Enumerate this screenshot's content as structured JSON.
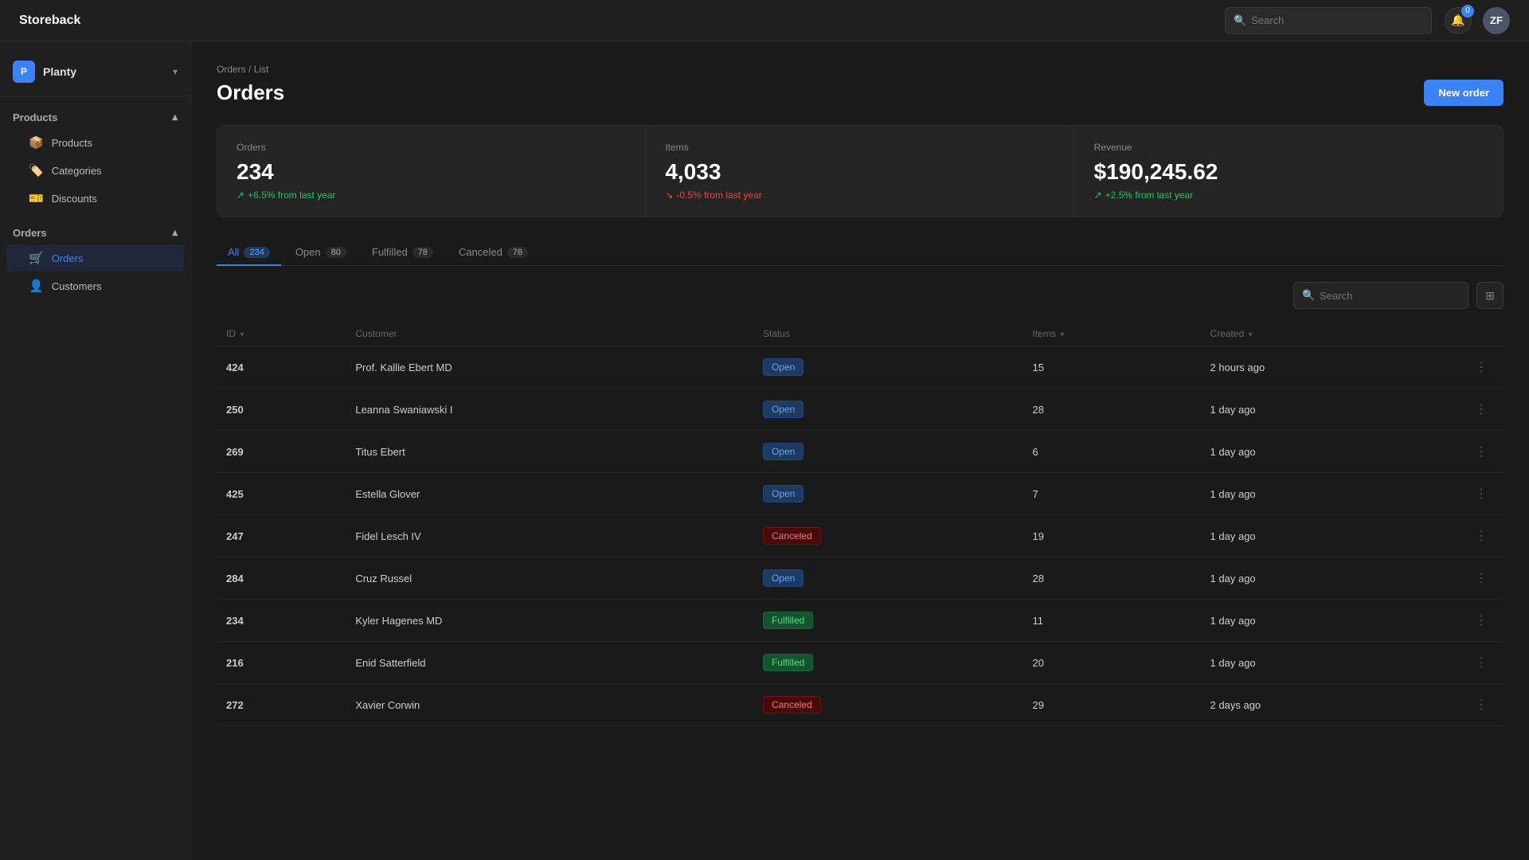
{
  "app": {
    "logo": "Storeback",
    "search_placeholder": "Search",
    "avatar_initials": "ZF",
    "notification_count": "0"
  },
  "sidebar": {
    "workspace": {
      "icon_letter": "P",
      "name": "Planty"
    },
    "sections": [
      {
        "label": "Products",
        "items": [
          {
            "label": "Products",
            "icon": "📦",
            "id": "products"
          },
          {
            "label": "Categories",
            "icon": "🏷️",
            "id": "categories"
          },
          {
            "label": "Discounts",
            "icon": "🎫",
            "id": "discounts"
          }
        ]
      },
      {
        "label": "Orders",
        "items": [
          {
            "label": "Orders",
            "icon": "🛒",
            "id": "orders",
            "active": true
          },
          {
            "label": "Customers",
            "icon": "👤",
            "id": "customers"
          }
        ]
      }
    ]
  },
  "breadcrumb": {
    "parent": "Orders",
    "separator": "/",
    "current": "List"
  },
  "page": {
    "title": "Orders",
    "new_order_label": "New order"
  },
  "stats": [
    {
      "label": "Orders",
      "value": "234",
      "change": "+6.5% from last year",
      "positive": true
    },
    {
      "label": "Items",
      "value": "4,033",
      "change": "-0.5% from last year",
      "positive": false
    },
    {
      "label": "Revenue",
      "value": "$190,245.62",
      "change": "+2.5% from last year",
      "positive": true
    }
  ],
  "tabs": [
    {
      "label": "All",
      "count": "234",
      "active": true,
      "id": "all"
    },
    {
      "label": "Open",
      "count": "80",
      "active": false,
      "id": "open"
    },
    {
      "label": "Fulfilled",
      "count": "78",
      "active": false,
      "id": "fulfilled"
    },
    {
      "label": "Canceled",
      "count": "76",
      "active": false,
      "id": "canceled"
    }
  ],
  "table": {
    "search_placeholder": "Search",
    "columns": [
      {
        "label": "ID",
        "sortable": true
      },
      {
        "label": "Customer",
        "sortable": false
      },
      {
        "label": "Status",
        "sortable": false
      },
      {
        "label": "Items",
        "sortable": true
      },
      {
        "label": "Created",
        "sortable": true
      }
    ],
    "rows": [
      {
        "id": "424",
        "customer": "Prof. Kallie Ebert MD",
        "status": "Open",
        "status_type": "open",
        "items": "15",
        "created": "2 hours ago"
      },
      {
        "id": "250",
        "customer": "Leanna Swaniawski I",
        "status": "Open",
        "status_type": "open",
        "items": "28",
        "created": "1 day ago"
      },
      {
        "id": "269",
        "customer": "Titus Ebert",
        "status": "Open",
        "status_type": "open",
        "items": "6",
        "created": "1 day ago"
      },
      {
        "id": "425",
        "customer": "Estella Glover",
        "status": "Open",
        "status_type": "open",
        "items": "7",
        "created": "1 day ago"
      },
      {
        "id": "247",
        "customer": "Fidel Lesch IV",
        "status": "Canceled",
        "status_type": "canceled",
        "items": "19",
        "created": "1 day ago"
      },
      {
        "id": "284",
        "customer": "Cruz Russel",
        "status": "Open",
        "status_type": "open",
        "items": "28",
        "created": "1 day ago"
      },
      {
        "id": "234",
        "customer": "Kyler Hagenes MD",
        "status": "Fulfilled",
        "status_type": "fulfilled",
        "items": "11",
        "created": "1 day ago"
      },
      {
        "id": "216",
        "customer": "Enid Satterfield",
        "status": "Fulfilled",
        "status_type": "fulfilled",
        "items": "20",
        "created": "1 day ago"
      },
      {
        "id": "272",
        "customer": "Xavier Corwin",
        "status": "Canceled",
        "status_type": "canceled",
        "items": "29",
        "created": "2 days ago"
      }
    ]
  }
}
